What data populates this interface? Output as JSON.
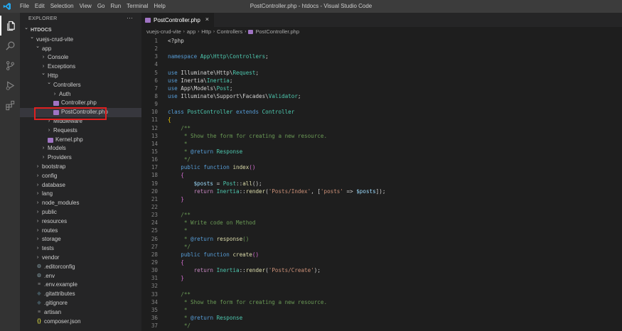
{
  "titlebar": {
    "window_title": "PostController.php - htdocs - Visual Studio Code",
    "menu": [
      "File",
      "Edit",
      "Selection",
      "View",
      "Go",
      "Run",
      "Terminal",
      "Help"
    ]
  },
  "activity_bar": [
    "files-icon",
    "search-icon",
    "source-control-icon",
    "run-debug-icon",
    "extensions-icon"
  ],
  "sidebar": {
    "header": "EXPLORER",
    "more": "···",
    "tree": [
      {
        "label": "HTDOCS",
        "depth": 0,
        "twist": "open",
        "kind": "root"
      },
      {
        "label": "vuejs-crud-vite",
        "depth": 1,
        "twist": "open",
        "kind": "folder"
      },
      {
        "label": "app",
        "depth": 2,
        "twist": "open",
        "kind": "folder"
      },
      {
        "label": "Console",
        "depth": 3,
        "twist": "closed",
        "kind": "folder"
      },
      {
        "label": "Exceptions",
        "depth": 3,
        "twist": "closed",
        "kind": "folder"
      },
      {
        "label": "Http",
        "depth": 3,
        "twist": "open",
        "kind": "folder"
      },
      {
        "label": "Controllers",
        "depth": 4,
        "twist": "open",
        "kind": "folder"
      },
      {
        "label": "Auth",
        "depth": 5,
        "twist": "closed",
        "kind": "folder"
      },
      {
        "label": "Controller.php",
        "depth": 5,
        "twist": "none",
        "kind": "php"
      },
      {
        "label": "PostController.php",
        "depth": 5,
        "twist": "none",
        "kind": "php",
        "selected": true
      },
      {
        "label": "Middleware",
        "depth": 4,
        "twist": "closed",
        "kind": "folder"
      },
      {
        "label": "Requests",
        "depth": 4,
        "twist": "closed",
        "kind": "folder"
      },
      {
        "label": "Kernel.php",
        "depth": 4,
        "twist": "none",
        "kind": "php"
      },
      {
        "label": "Models",
        "depth": 3,
        "twist": "closed",
        "kind": "folder"
      },
      {
        "label": "Providers",
        "depth": 3,
        "twist": "closed",
        "kind": "folder"
      },
      {
        "label": "bootstrap",
        "depth": 2,
        "twist": "closed",
        "kind": "folder"
      },
      {
        "label": "config",
        "depth": 2,
        "twist": "closed",
        "kind": "folder"
      },
      {
        "label": "database",
        "depth": 2,
        "twist": "closed",
        "kind": "folder"
      },
      {
        "label": "lang",
        "depth": 2,
        "twist": "closed",
        "kind": "folder"
      },
      {
        "label": "node_modules",
        "depth": 2,
        "twist": "closed",
        "kind": "folder"
      },
      {
        "label": "public",
        "depth": 2,
        "twist": "closed",
        "kind": "folder"
      },
      {
        "label": "resources",
        "depth": 2,
        "twist": "closed",
        "kind": "folder"
      },
      {
        "label": "routes",
        "depth": 2,
        "twist": "closed",
        "kind": "folder"
      },
      {
        "label": "storage",
        "depth": 2,
        "twist": "closed",
        "kind": "folder"
      },
      {
        "label": "tests",
        "depth": 2,
        "twist": "closed",
        "kind": "folder"
      },
      {
        "label": "vendor",
        "depth": 2,
        "twist": "closed",
        "kind": "folder"
      },
      {
        "label": ".editorconfig",
        "depth": 2,
        "twist": "none",
        "kind": "gear"
      },
      {
        "label": ".env",
        "depth": 2,
        "twist": "none",
        "kind": "gear"
      },
      {
        "label": ".env.example",
        "depth": 2,
        "twist": "none",
        "kind": "lines"
      },
      {
        "label": ".gitattributes",
        "depth": 2,
        "twist": "none",
        "kind": "git"
      },
      {
        "label": ".gitignore",
        "depth": 2,
        "twist": "none",
        "kind": "git"
      },
      {
        "label": "artisan",
        "depth": 2,
        "twist": "none",
        "kind": "lines"
      },
      {
        "label": "composer.json",
        "depth": 2,
        "twist": "none",
        "kind": "json"
      }
    ]
  },
  "editor": {
    "tab_label": "PostController.php",
    "tab_close": "×",
    "breadcrumbs": [
      "vuejs-crud-vite",
      "app",
      "Http",
      "Controllers",
      "PostController.php"
    ],
    "lines": [
      {
        "n": "1",
        "t": [
          [
            "plain",
            "<?php"
          ]
        ]
      },
      {
        "n": "2",
        "t": []
      },
      {
        "n": "3",
        "t": [
          [
            "kw",
            "namespace "
          ],
          [
            "ns",
            "App\\Http\\Controllers"
          ],
          [
            "plain",
            ";"
          ]
        ]
      },
      {
        "n": "4",
        "t": []
      },
      {
        "n": "5",
        "t": [
          [
            "kw",
            "use "
          ],
          [
            "plain",
            "Illuminate\\Http\\"
          ],
          [
            "cls",
            "Request"
          ],
          [
            "plain",
            ";"
          ]
        ]
      },
      {
        "n": "6",
        "t": [
          [
            "kw",
            "use "
          ],
          [
            "plain",
            "Inertia\\"
          ],
          [
            "cls",
            "Inertia"
          ],
          [
            "plain",
            ";"
          ]
        ]
      },
      {
        "n": "7",
        "t": [
          [
            "kw",
            "use "
          ],
          [
            "plain",
            "App\\Models\\"
          ],
          [
            "cls",
            "Post"
          ],
          [
            "plain",
            ";"
          ]
        ]
      },
      {
        "n": "8",
        "t": [
          [
            "kw",
            "use "
          ],
          [
            "plain",
            "Illuminate\\Support\\Facades\\"
          ],
          [
            "cls",
            "Validator"
          ],
          [
            "plain",
            ";"
          ]
        ]
      },
      {
        "n": "9",
        "t": []
      },
      {
        "n": "10",
        "t": [
          [
            "kw",
            "class "
          ],
          [
            "cls",
            "PostController "
          ],
          [
            "kw",
            "extends "
          ],
          [
            "cls",
            "Controller"
          ]
        ]
      },
      {
        "n": "11",
        "t": [
          [
            "br",
            "{"
          ]
        ]
      },
      {
        "n": "12",
        "t": [
          [
            "cm",
            "    /**"
          ]
        ]
      },
      {
        "n": "13",
        "t": [
          [
            "cm",
            "     * Show the form for creating a new resource."
          ]
        ]
      },
      {
        "n": "14",
        "t": [
          [
            "cm",
            "     *"
          ]
        ]
      },
      {
        "n": "15",
        "t": [
          [
            "cm",
            "     * "
          ],
          [
            "kw",
            "@return "
          ],
          [
            "cls",
            "Response"
          ]
        ]
      },
      {
        "n": "16",
        "t": [
          [
            "cm",
            "     */"
          ]
        ]
      },
      {
        "n": "17",
        "t": [
          [
            "kw",
            "    public function "
          ],
          [
            "fn",
            "index"
          ],
          [
            "br2",
            "()"
          ]
        ]
      },
      {
        "n": "18",
        "t": [
          [
            "br2",
            "    {"
          ]
        ]
      },
      {
        "n": "19",
        "t": [
          [
            "var",
            "        $posts "
          ],
          [
            "plain",
            "= "
          ],
          [
            "cls",
            "Post"
          ],
          [
            "plain",
            "::"
          ],
          [
            "fn",
            "all"
          ],
          [
            "plain",
            "();"
          ]
        ]
      },
      {
        "n": "20",
        "t": [
          [
            "ctl",
            "        return "
          ],
          [
            "cls",
            "Inertia"
          ],
          [
            "plain",
            "::"
          ],
          [
            "fn",
            "render"
          ],
          [
            "plain",
            "("
          ],
          [
            "str",
            "'Posts/Index'"
          ],
          [
            "plain",
            ", ["
          ],
          [
            "str",
            "'posts'"
          ],
          [
            "plain",
            " => "
          ],
          [
            "var",
            "$posts"
          ],
          [
            "plain",
            "]);"
          ]
        ]
      },
      {
        "n": "21",
        "t": [
          [
            "br2",
            "    }"
          ]
        ]
      },
      {
        "n": "22",
        "t": []
      },
      {
        "n": "23",
        "t": [
          [
            "cm",
            "    /**"
          ]
        ]
      },
      {
        "n": "24",
        "t": [
          [
            "cm",
            "     * Write code on Method"
          ]
        ]
      },
      {
        "n": "25",
        "t": [
          [
            "cm",
            "     *"
          ]
        ]
      },
      {
        "n": "26",
        "t": [
          [
            "cm",
            "     * "
          ],
          [
            "kw",
            "@return "
          ],
          [
            "fn",
            "response"
          ],
          [
            "cm",
            "()"
          ]
        ]
      },
      {
        "n": "27",
        "t": [
          [
            "cm",
            "     */"
          ]
        ]
      },
      {
        "n": "28",
        "t": [
          [
            "kw",
            "    public function "
          ],
          [
            "fn",
            "create"
          ],
          [
            "br2",
            "()"
          ]
        ]
      },
      {
        "n": "29",
        "t": [
          [
            "br2",
            "    {"
          ]
        ]
      },
      {
        "n": "30",
        "t": [
          [
            "ctl",
            "        return "
          ],
          [
            "cls",
            "Inertia"
          ],
          [
            "plain",
            "::"
          ],
          [
            "fn",
            "render"
          ],
          [
            "plain",
            "("
          ],
          [
            "str",
            "'Posts/Create'"
          ],
          [
            "plain",
            ");"
          ]
        ]
      },
      {
        "n": "31",
        "t": [
          [
            "br2",
            "    }"
          ]
        ]
      },
      {
        "n": "32",
        "t": []
      },
      {
        "n": "33",
        "t": [
          [
            "cm",
            "    /**"
          ]
        ]
      },
      {
        "n": "34",
        "t": [
          [
            "cm",
            "     * Show the form for creating a new resource."
          ]
        ]
      },
      {
        "n": "35",
        "t": [
          [
            "cm",
            "     *"
          ]
        ]
      },
      {
        "n": "36",
        "t": [
          [
            "cm",
            "     * "
          ],
          [
            "kw",
            "@return "
          ],
          [
            "cls",
            "Response"
          ]
        ]
      },
      {
        "n": "37",
        "t": [
          [
            "cm",
            "     */"
          ]
        ]
      }
    ]
  }
}
